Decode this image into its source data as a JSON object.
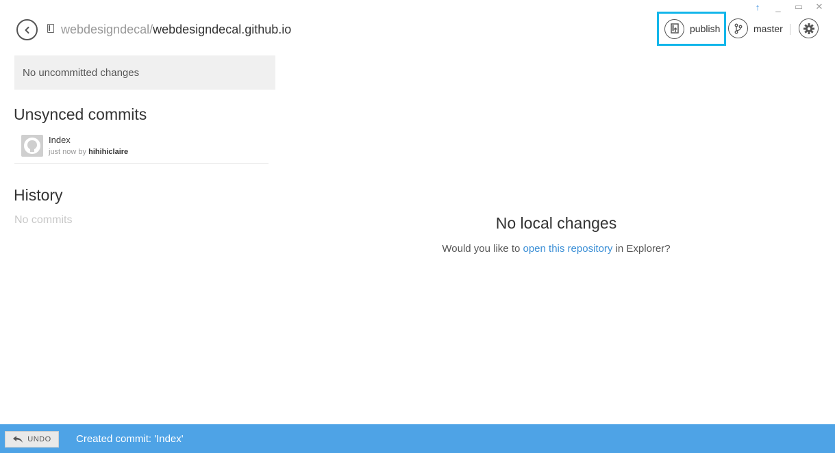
{
  "window": {
    "controls": {
      "sync": "↑",
      "minimize": "_",
      "maximize": "▭",
      "close": "✕"
    }
  },
  "header": {
    "repo_owner": "webdesigndecal/",
    "repo_name": "webdesigndecal.github.io",
    "publish_label": "publish",
    "branch_label": "master"
  },
  "left_panel": {
    "uncommitted_text": "No uncommitted changes",
    "unsynced_title": "Unsynced commits",
    "commits": [
      {
        "title": "Index",
        "time": "just now by ",
        "author": "hihihiclaire"
      }
    ],
    "history_title": "History",
    "history_empty": "No commits"
  },
  "main": {
    "empty_title": "No local changes",
    "empty_prefix": "Would you like to ",
    "empty_link": "open this repository",
    "empty_suffix": " in Explorer?"
  },
  "notification": {
    "undo_label": "UNDO",
    "message": "Created commit: 'Index'"
  },
  "colors": {
    "accent": "#4ea3e6",
    "highlight": "#13b6ea",
    "link": "#3b8fd6"
  },
  "icons": [
    "back-icon",
    "repo-icon",
    "publish-icon",
    "branch-icon",
    "gear-icon",
    "github-avatar-icon",
    "undo-arrow-icon"
  ]
}
